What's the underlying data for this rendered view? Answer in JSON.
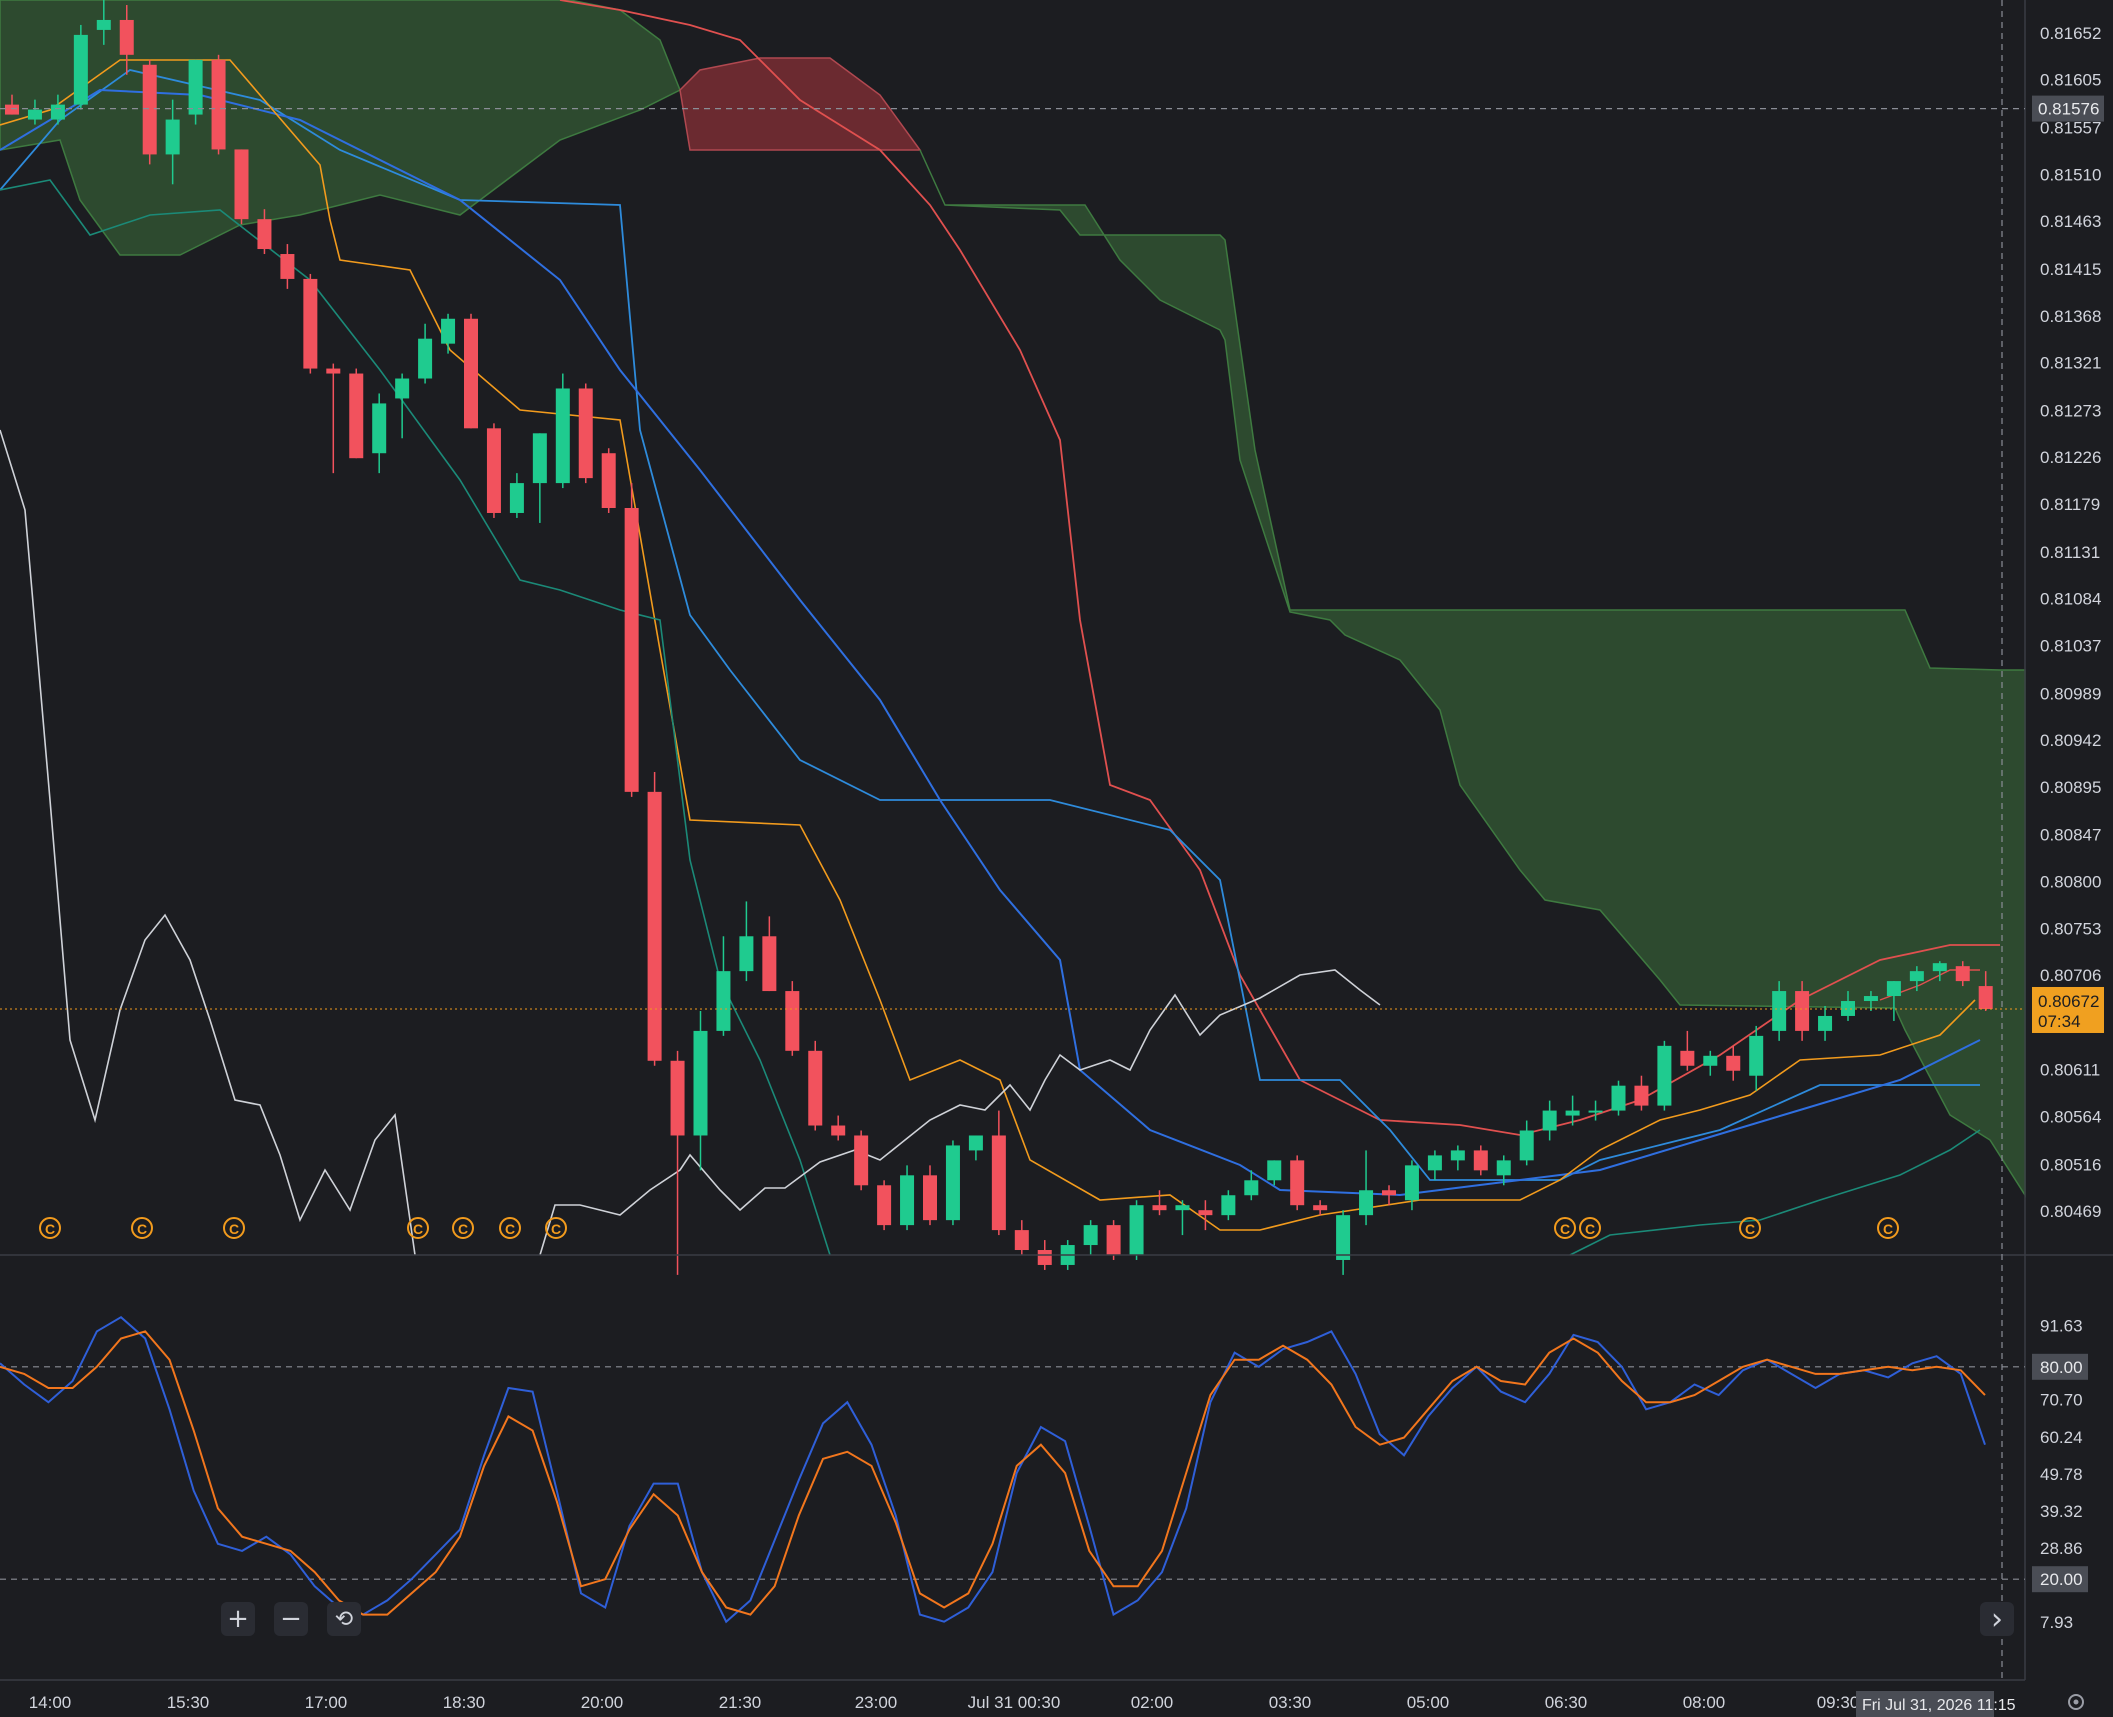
{
  "theme": {
    "bg": "#1c1d21",
    "grid": "#2a2c33",
    "text": "#d1d4dc",
    "bull": "#1fcb8f",
    "bear": "#f2525d",
    "orange": "#f29b1d",
    "blue": "#2f6fe0",
    "lightblue": "#2e8bdb",
    "teal": "#1b8a78",
    "white": "#cfd2d8",
    "kumo_bull": "#2d4a2f",
    "kumo_bear": "#6b2a30",
    "stoch_k": "#2f5fd8",
    "stoch_d": "#f2761d"
  },
  "chart_data": [
    {
      "type": "candlestick",
      "panel": "price",
      "x_ticks": [
        "14:00",
        "15:30",
        "17:00",
        "18:30",
        "20:00",
        "21:30",
        "23:00",
        "Jul 31 00:30",
        "02:00",
        "03:30",
        "05:00",
        "06:30",
        "08:00",
        "09:30"
      ],
      "y_ticks": [
        "0.81652",
        "0.81605",
        "0.81557",
        "0.81510",
        "0.81463",
        "0.81415",
        "0.81368",
        "0.81321",
        "0.81273",
        "0.81226",
        "0.81179",
        "0.81131",
        "0.81084",
        "0.81037",
        "0.80989",
        "0.80942",
        "0.80895",
        "0.80847",
        "0.80800",
        "0.80753",
        "0.80706",
        "0.80611",
        "0.80564",
        "0.80516",
        "0.80469"
      ],
      "ylim": [
        0.80425,
        0.81675
      ],
      "current_price": "0.80672",
      "countdown": "07:34",
      "crosshair_price": "0.81576",
      "crosshair_time": "Fri Jul 31, 2026 11:15",
      "candle_close_lines": [
        "0.81576",
        "0.80672"
      ],
      "candles": [
        [
          0.8158,
          0.8159,
          0.8157,
          0.8157
        ],
        [
          0.81565,
          0.81585,
          0.8156,
          0.81575
        ],
        [
          0.81565,
          0.8159,
          0.8156,
          0.8158
        ],
        [
          0.8158,
          0.8166,
          0.81575,
          0.8165
        ],
        [
          0.81655,
          0.817,
          0.8164,
          0.81665
        ],
        [
          0.81665,
          0.8168,
          0.8161,
          0.8163
        ],
        [
          0.8162,
          0.81625,
          0.8152,
          0.8153
        ],
        [
          0.8153,
          0.81585,
          0.815,
          0.81565
        ],
        [
          0.8157,
          0.81625,
          0.8156,
          0.81625
        ],
        [
          0.81625,
          0.8163,
          0.8153,
          0.81535
        ],
        [
          0.81535,
          0.81535,
          0.8146,
          0.81465
        ],
        [
          0.81465,
          0.81475,
          0.8143,
          0.81435
        ],
        [
          0.8143,
          0.8144,
          0.81395,
          0.81405
        ],
        [
          0.81405,
          0.8141,
          0.8131,
          0.81315
        ],
        [
          0.81315,
          0.8132,
          0.8121,
          0.8131
        ],
        [
          0.8131,
          0.81315,
          0.81225,
          0.81225
        ],
        [
          0.8123,
          0.8129,
          0.8121,
          0.8128
        ],
        [
          0.81285,
          0.8131,
          0.81245,
          0.81305
        ],
        [
          0.81305,
          0.8136,
          0.813,
          0.81345
        ],
        [
          0.8134,
          0.8137,
          0.8133,
          0.81365
        ],
        [
          0.81365,
          0.8137,
          0.81255,
          0.81255
        ],
        [
          0.81255,
          0.8126,
          0.81165,
          0.8117
        ],
        [
          0.8117,
          0.8121,
          0.81165,
          0.812
        ],
        [
          0.812,
          0.8125,
          0.8116,
          0.8125
        ],
        [
          0.812,
          0.8131,
          0.81195,
          0.81295
        ],
        [
          0.81295,
          0.813,
          0.812,
          0.81205
        ],
        [
          0.8123,
          0.81235,
          0.8117,
          0.81175
        ],
        [
          0.81175,
          0.812,
          0.80885,
          0.8089
        ],
        [
          0.8089,
          0.8091,
          0.80615,
          0.8062
        ],
        [
          0.8062,
          0.8063,
          0.80405,
          0.80545
        ],
        [
          0.80545,
          0.8067,
          0.8051,
          0.8065
        ],
        [
          0.8065,
          0.80745,
          0.80645,
          0.8071
        ],
        [
          0.8071,
          0.8078,
          0.807,
          0.80745
        ],
        [
          0.80745,
          0.80765,
          0.8069,
          0.8069
        ],
        [
          0.8069,
          0.807,
          0.80625,
          0.8063
        ],
        [
          0.8063,
          0.8064,
          0.8055,
          0.80555
        ],
        [
          0.80555,
          0.80565,
          0.8054,
          0.80545
        ],
        [
          0.80545,
          0.8055,
          0.8049,
          0.80495
        ],
        [
          0.80495,
          0.805,
          0.8045,
          0.80455
        ],
        [
          0.80455,
          0.80515,
          0.8045,
          0.80505
        ],
        [
          0.80505,
          0.80515,
          0.80455,
          0.8046
        ],
        [
          0.8046,
          0.8054,
          0.80455,
          0.80535
        ],
        [
          0.8053,
          0.80545,
          0.8052,
          0.80545
        ],
        [
          0.80545,
          0.8057,
          0.80445,
          0.8045
        ],
        [
          0.8045,
          0.8046,
          0.80425,
          0.8043
        ],
        [
          0.8043,
          0.8044,
          0.8041,
          0.80415
        ],
        [
          0.80415,
          0.8044,
          0.8041,
          0.80435
        ],
        [
          0.80435,
          0.8046,
          0.80425,
          0.80455
        ],
        [
          0.80455,
          0.8046,
          0.8042,
          0.80425
        ],
        [
          0.80425,
          0.8048,
          0.8042,
          0.80475
        ],
        [
          0.80475,
          0.8049,
          0.80465,
          0.8047
        ],
        [
          0.8047,
          0.8048,
          0.80445,
          0.80475
        ],
        [
          0.8047,
          0.8048,
          0.8045,
          0.80465
        ],
        [
          0.80465,
          0.8049,
          0.8046,
          0.80485
        ],
        [
          0.80485,
          0.8051,
          0.8048,
          0.805
        ],
        [
          0.805,
          0.8052,
          0.80495,
          0.8052
        ],
        [
          0.8052,
          0.80525,
          0.8047,
          0.80475
        ],
        [
          0.80475,
          0.8048,
          0.80465,
          0.8047
        ],
        [
          0.8042,
          0.8047,
          0.80405,
          0.80465
        ],
        [
          0.80465,
          0.8053,
          0.80455,
          0.8049
        ],
        [
          0.8049,
          0.80495,
          0.80475,
          0.80485
        ],
        [
          0.8048,
          0.8052,
          0.8047,
          0.80515
        ],
        [
          0.8051,
          0.8053,
          0.805,
          0.80525
        ],
        [
          0.8052,
          0.80535,
          0.8051,
          0.8053
        ],
        [
          0.8053,
          0.80535,
          0.80505,
          0.8051
        ],
        [
          0.80505,
          0.80525,
          0.80495,
          0.8052
        ],
        [
          0.8052,
          0.8056,
          0.80515,
          0.8055
        ],
        [
          0.8055,
          0.8058,
          0.8054,
          0.8057
        ],
        [
          0.80565,
          0.80585,
          0.80555,
          0.8057
        ],
        [
          0.8057,
          0.8058,
          0.8056,
          0.8057
        ],
        [
          0.8057,
          0.806,
          0.80565,
          0.80595
        ],
        [
          0.80595,
          0.80605,
          0.8057,
          0.80575
        ],
        [
          0.80575,
          0.8064,
          0.8057,
          0.80635
        ],
        [
          0.8063,
          0.8065,
          0.8061,
          0.80615
        ],
        [
          0.80615,
          0.8063,
          0.80605,
          0.80625
        ],
        [
          0.80625,
          0.80635,
          0.806,
          0.8061
        ],
        [
          0.80605,
          0.80655,
          0.8059,
          0.80645
        ],
        [
          0.8065,
          0.807,
          0.8064,
          0.8069
        ],
        [
          0.8069,
          0.807,
          0.8064,
          0.8065
        ],
        [
          0.8065,
          0.80675,
          0.8064,
          0.80665
        ],
        [
          0.80665,
          0.8069,
          0.8066,
          0.8068
        ],
        [
          0.8068,
          0.8069,
          0.8067,
          0.80685
        ],
        [
          0.80685,
          0.807,
          0.8066,
          0.807
        ],
        [
          0.807,
          0.80715,
          0.8069,
          0.8071
        ],
        [
          0.8071,
          0.8072,
          0.807,
          0.80718
        ],
        [
          0.80715,
          0.8072,
          0.80695,
          0.807
        ],
        [
          0.80695,
          0.8071,
          0.8067,
          0.80672
        ]
      ],
      "overlays": {
        "orange_line": [
          0.8159,
          0.81595,
          0.816,
          0.81615,
          0.8162,
          0.8162,
          0.8162,
          0.8162,
          0.81615,
          0.81555,
          0.81525,
          0.8149,
          0.8146,
          0.81415,
          0.8141,
          0.8141,
          0.814,
          0.8138,
          0.8133,
          0.813,
          0.8129,
          0.8126,
          0.81245,
          0.81245,
          0.81245,
          0.81245,
          0.8123,
          0.8109,
          0.809,
          0.80855,
          0.80855,
          0.80855,
          0.80855,
          0.80835,
          0.808,
          0.8063,
          0.8059,
          0.80605,
          0.80605,
          0.80595,
          0.8057,
          0.8055,
          0.8055,
          0.80535,
          0.8047,
          0.80465,
          0.80465,
          0.80465,
          0.80465,
          0.80465,
          0.80465,
          0.80465,
          0.80465,
          0.80445,
          0.80445,
          0.8046,
          0.8047,
          0.8047,
          0.8047,
          0.80475,
          0.8048,
          0.8048,
          0.8048,
          0.8048,
          0.8048,
          0.8049,
          0.80515,
          0.80525,
          0.80535,
          0.8054,
          0.80555,
          0.80575,
          0.8058,
          0.8059,
          0.8059,
          0.80605,
          0.80615,
          0.80615,
          0.80615,
          0.80625,
          0.80635,
          0.80645,
          0.80645,
          0.8065,
          0.8066,
          0.8067,
          0.80672
        ],
        "blue_line": [
          0.81535,
          0.8156,
          0.81585,
          0.816,
          0.81615,
          0.8161,
          0.8162,
          0.81615,
          0.8161,
          0.81585,
          0.8156,
          0.8153,
          0.8149,
          0.8147,
          0.8145,
          0.8144,
          0.8142,
          0.814,
          0.8138,
          0.8135,
          0.81325,
          0.813,
          0.8127,
          0.81245,
          0.8122,
          0.8119,
          0.8116,
          0.81105,
          0.81055,
          0.8101,
          0.80975,
          0.8094,
          0.80905,
          0.8087,
          0.8083,
          0.8079,
          0.8075,
          0.80715,
          0.8068,
          0.8064,
          0.8061,
          0.8058,
          0.80555,
          0.8053,
          0.8051,
          0.80495,
          0.80485,
          0.80475,
          0.8047,
          0.80465,
          0.80465,
          0.80465,
          0.8047,
          0.80475,
          0.8048,
          0.8048,
          0.80485,
          0.8049,
          0.80495,
          0.805,
          0.80505,
          0.8051,
          0.80515,
          0.8052,
          0.8053,
          0.8054,
          0.8055,
          0.8056,
          0.8057,
          0.8058,
          0.8059,
          0.806,
          0.8061,
          0.8062,
          0.8063,
          0.8064
        ]
      }
    },
    {
      "type": "line",
      "panel": "stochastic",
      "y_ticks": [
        "91.63",
        "80.00",
        "70.70",
        "60.24",
        "49.78",
        "39.32",
        "28.86",
        "20.00",
        "7.93"
      ],
      "ylim": [
        0,
        100
      ],
      "bands": [
        80,
        20
      ],
      "series": [
        {
          "values": [
            81,
            75,
            70,
            76,
            90,
            94,
            88,
            68,
            45,
            30,
            28,
            32,
            27,
            18,
            12,
            10,
            14,
            20,
            27,
            34,
            55,
            74,
            73,
            45,
            16,
            12,
            35,
            47,
            47,
            22,
            8,
            14,
            31,
            48,
            64,
            70,
            58,
            38,
            10,
            8,
            12,
            22,
            50,
            63,
            59,
            35,
            10,
            14,
            22,
            40,
            70,
            84,
            80,
            85,
            87,
            90,
            78,
            61,
            55,
            66,
            74,
            80,
            73,
            70,
            78,
            89,
            87,
            80,
            68,
            70,
            75,
            72,
            79,
            82,
            78,
            74,
            78,
            79,
            77,
            81,
            83,
            78,
            58
          ]
        },
        {
          "values": [
            80,
            78,
            74,
            74,
            80,
            88,
            90,
            82,
            62,
            40,
            32,
            30,
            28,
            22,
            14,
            10,
            10,
            16,
            22,
            32,
            52,
            66,
            62,
            42,
            18,
            20,
            34,
            44,
            38,
            22,
            12,
            10,
            18,
            38,
            54,
            56,
            52,
            36,
            16,
            12,
            16,
            30,
            52,
            58,
            50,
            28,
            18,
            18,
            28,
            50,
            72,
            82,
            82,
            86,
            82,
            75,
            63,
            58,
            60,
            68,
            76,
            80,
            76,
            75,
            84,
            88,
            84,
            76,
            70,
            70,
            72,
            76,
            80,
            82,
            80,
            78,
            78,
            79,
            80,
            79,
            80,
            79,
            72
          ]
        }
      ]
    }
  ],
  "price_labels": {
    "crosshair": "0.81576",
    "current": "0.80672",
    "countdown": "07:34"
  },
  "stoch_labels": {
    "upper_band": "80.00",
    "lower_band": "20.00"
  },
  "time_label": "Fri Jul 31, 2026 11:15",
  "controls": {
    "zoom_in": "+",
    "zoom_out": "−",
    "reset": "⟲",
    "scroll_right": "›"
  }
}
